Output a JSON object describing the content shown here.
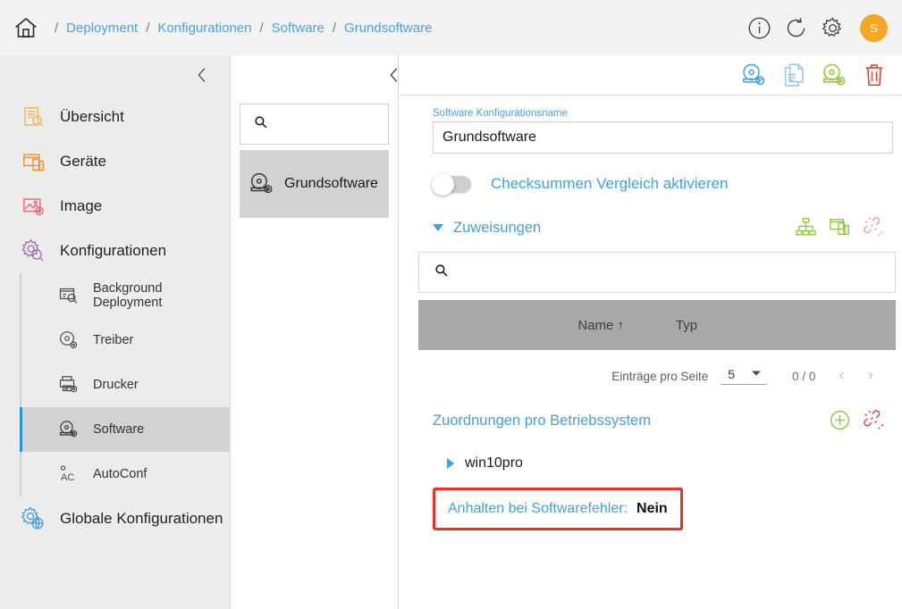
{
  "header": {
    "home_icon": "home-icon",
    "breadcrumbs": [
      "Deployment",
      "Konfigurationen",
      "Software",
      "Grundsoftware"
    ],
    "separator": "/",
    "actions": [
      {
        "name": "info-icon",
        "label": "Info"
      },
      {
        "name": "refresh-icon",
        "label": "Aktualisieren"
      },
      {
        "name": "gear-icon",
        "label": "Einstellungen"
      }
    ],
    "avatar_initial": "S",
    "avatar_color": "#f5a623"
  },
  "sidebar": {
    "collapse_icon": "chevron-left-icon",
    "items": [
      {
        "label": "Übersicht",
        "icon": "overview-icon",
        "color": "#f0b24a"
      },
      {
        "label": "Geräte",
        "icon": "devices-icon",
        "color": "#ef8b2c"
      },
      {
        "label": "Image",
        "icon": "image-icon",
        "color": "#e8626b"
      },
      {
        "label": "Konfigurationen",
        "icon": "configurations-icon",
        "color": "#9b6bb5"
      }
    ],
    "sub_items": [
      {
        "label": "Background Deployment",
        "icon": "background-deployment-icon",
        "selected": false
      },
      {
        "label": "Treiber",
        "icon": "driver-icon",
        "selected": false
      },
      {
        "label": "Drucker",
        "icon": "printer-icon",
        "selected": false
      },
      {
        "label": "Software",
        "icon": "software-icon",
        "selected": true
      },
      {
        "label": "AutoConf",
        "icon": "autoconf-icon",
        "selected": false
      }
    ],
    "global": {
      "label": "Globale Konfigurationen",
      "icon": "global-configurations-icon",
      "color": "#3f9fd6"
    },
    "accent_color": "#2196d6",
    "selected_bg": "#d2d2d2"
  },
  "list_panel": {
    "search_icon": "search-icon",
    "search_value": "",
    "search_placeholder": "",
    "entries": [
      {
        "label": "Grundsoftware",
        "icon": "software-disc-icon",
        "selected": true
      }
    ]
  },
  "main": {
    "toolbar": {
      "back_icon": "chevron-left-icon",
      "actions": [
        {
          "name": "edit-software-icon",
          "color": "#3fa2e0"
        },
        {
          "name": "copy-document-icon",
          "color": "#8ec7e8"
        },
        {
          "name": "add-software-icon",
          "color": "#8cc63f"
        },
        {
          "name": "delete-icon",
          "color": "#ef4136"
        }
      ]
    },
    "name_field": {
      "label": "Software Konfigurationsname",
      "value": "Grundsoftware",
      "placeholder": ""
    },
    "checksum_toggle": {
      "label": "Checksummen Vergleich aktivieren",
      "state": "off"
    },
    "assignments": {
      "title": "Zuweisungen",
      "expanded": true,
      "actions": [
        {
          "name": "org-tree-icon",
          "color": "#8cc63f"
        },
        {
          "name": "device-assign-icon",
          "color": "#8cc63f"
        },
        {
          "name": "unlink-icon",
          "color": "#f4a0a0"
        }
      ],
      "search_value": "",
      "search_placeholder": "",
      "table": {
        "columns": [
          "Name",
          "Typ"
        ],
        "sort_column": "Name",
        "sort_direction": "asc",
        "sort_glyph": "↑",
        "rows": []
      },
      "pagination": {
        "per_page_label": "Einträge pro Seite",
        "per_page_value": "5",
        "count_text": "0 / 0",
        "prev_glyph": "‹",
        "next_glyph": "›"
      }
    },
    "os_assignments": {
      "title": "Zuordnungen pro Betriebssystem",
      "actions": [
        {
          "name": "add-circle-icon",
          "color": "#8cc63f"
        },
        {
          "name": "unlink-icon",
          "color": "#ef4136"
        }
      ],
      "entries": [
        {
          "label": "win10pro",
          "expanded": false
        }
      ]
    },
    "halt_on_error": {
      "label": "Anhalten bei Softwarefehler:",
      "value": "Nein",
      "highlight_color": "#f03028"
    }
  }
}
